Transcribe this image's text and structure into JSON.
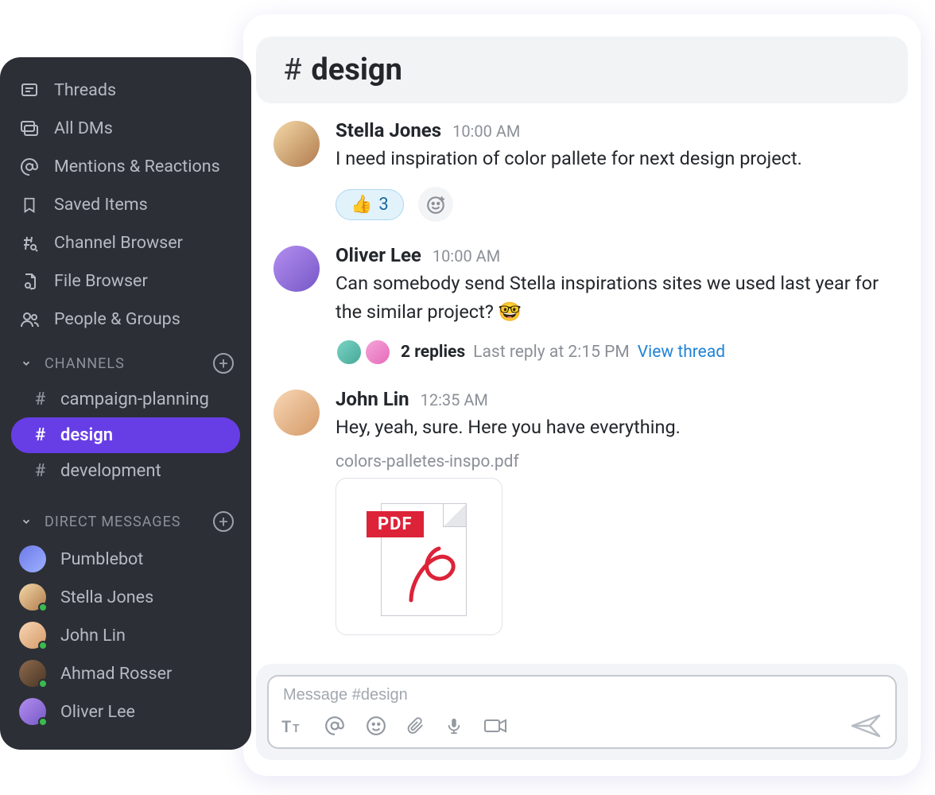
{
  "sidebar": {
    "nav": [
      {
        "label": "Threads"
      },
      {
        "label": "All DMs"
      },
      {
        "label": "Mentions & Reactions"
      },
      {
        "label": "Saved Items"
      },
      {
        "label": "Channel Browser"
      },
      {
        "label": "File Browser"
      },
      {
        "label": "People & Groups"
      }
    ],
    "channels_section_label": "CHANNELS",
    "channels": [
      {
        "name": "campaign-planning",
        "active": false
      },
      {
        "name": "design",
        "active": true
      },
      {
        "name": "development",
        "active": false
      }
    ],
    "dms_section_label": "DIRECT MESSAGES",
    "dms": [
      {
        "name": "Pumblebot",
        "presence": false
      },
      {
        "name": "Stella Jones",
        "presence": true
      },
      {
        "name": "John Lin",
        "presence": true
      },
      {
        "name": "Ahmad Rosser",
        "presence": true
      },
      {
        "name": "Oliver Lee",
        "presence": true
      }
    ]
  },
  "channel_header": {
    "hash": "#",
    "title": "design"
  },
  "messages": [
    {
      "author": "Stella Jones",
      "time": "10:00 AM",
      "text": "I need inspiration of color pallete for next design project.",
      "reaction": {
        "emoji": "👍",
        "count": "3"
      }
    },
    {
      "author": "Oliver Lee",
      "time": "10:00 AM",
      "text": "Can somebody send Stella inspirations sites we used last year for the similar project? 🤓",
      "thread": {
        "replies_label": "2 replies",
        "last_reply_label": "Last reply at 2:15 PM",
        "view_label": "View thread"
      }
    },
    {
      "author": "John Lin",
      "time": "12:35 AM",
      "text": "Hey, yeah, sure. Here you have everything.",
      "file": {
        "name": "colors-palletes-inspo.pdf",
        "badge": "PDF"
      }
    }
  ],
  "composer": {
    "placeholder": "Message #design"
  }
}
